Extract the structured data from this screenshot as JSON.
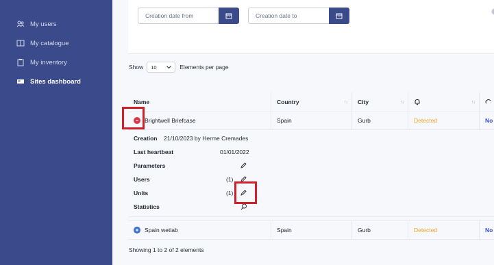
{
  "sidebar": {
    "items": [
      {
        "label": "My users",
        "icon": "users-icon"
      },
      {
        "label": "My catalogue",
        "icon": "book-icon"
      },
      {
        "label": "My inventory",
        "icon": "clipboard-icon"
      },
      {
        "label": "Sites dashboard",
        "icon": "dashboard-icon"
      }
    ],
    "active_index": 3
  },
  "filters": {
    "creation_from_placeholder": "Creation date from",
    "creation_to_placeholder": "Creation date to"
  },
  "paging": {
    "show_label": "Show",
    "page_size": "10",
    "per_page_label": "Elements per page"
  },
  "table": {
    "columns": [
      "Name",
      "Country",
      "City",
      "",
      ""
    ],
    "rows": [
      {
        "name": "Brightwell Briefcase",
        "country": "Spain",
        "city": "Gurb",
        "status": "Detected",
        "extra": "No"
      },
      {
        "name": "Spain wetlab",
        "country": "Spain",
        "city": "Gurb",
        "status": "Detected",
        "extra": "No"
      }
    ],
    "detail": {
      "creation_label": "Creation",
      "creation_value": "21/10/2023 by Herme Cremades",
      "heartbeat_label": "Last heartbeat",
      "heartbeat_value": "01/01/2022",
      "parameters_label": "Parameters",
      "users_label": "Users",
      "users_count": "(1)",
      "units_label": "Units",
      "units_count": "(1)",
      "statistics_label": "Statistics"
    }
  },
  "footer": {
    "summary": "Showing 1 to 2 of 2 elements"
  },
  "colors": {
    "sidebar": "#3a4a8a",
    "accent": "#3a4a8a",
    "detected": "#f0a42a",
    "highlight": "#d0202a",
    "collapse_icon": "#e0344a",
    "expand_icon": "#3b6fd8"
  }
}
